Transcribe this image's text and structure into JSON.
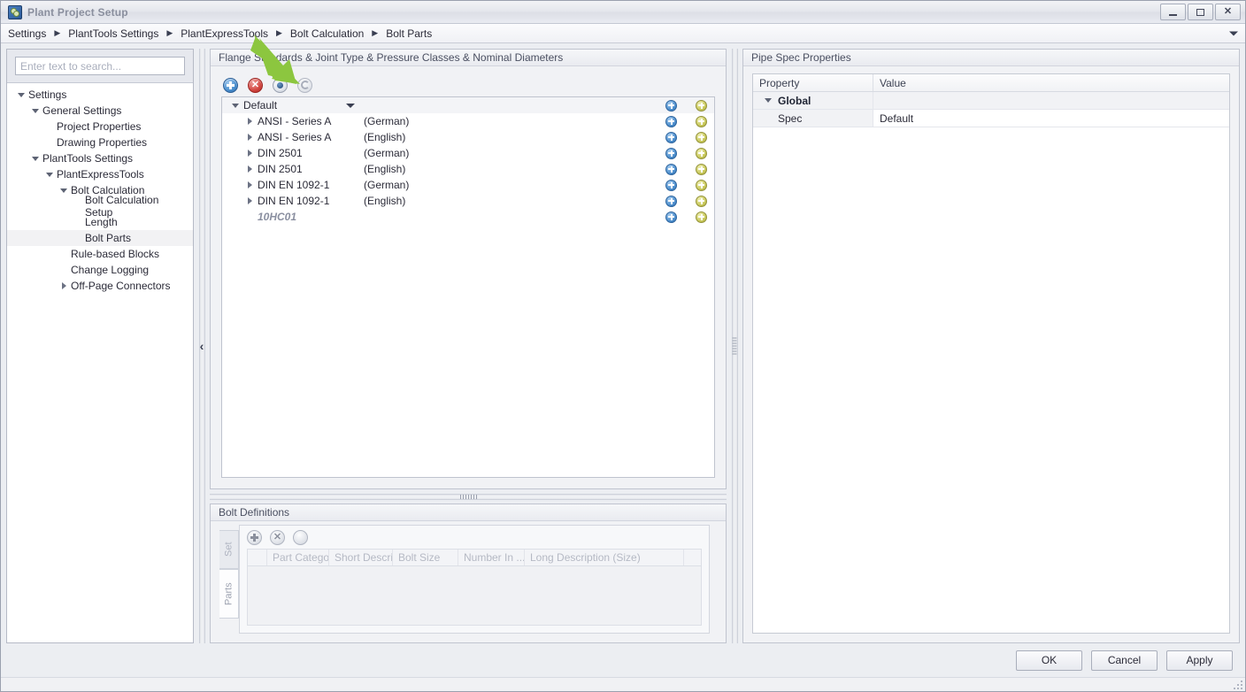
{
  "window": {
    "title": "Plant Project Setup",
    "icon": "app-icon",
    "controls": {
      "minimize": "–",
      "maximize": "□",
      "close": "✕"
    }
  },
  "breadcrumb": {
    "items": [
      "Settings",
      "PlantTools Settings",
      "PlantExpressTools",
      "Bolt Calculation",
      "Bolt Parts"
    ],
    "separator": "▶",
    "dropdown_icon": "chevron-down-icon"
  },
  "sidebar": {
    "search": {
      "placeholder": "Enter text to search...",
      "value": ""
    },
    "tree": [
      {
        "label": "Settings",
        "depth": 0,
        "state": "expanded",
        "selected": false
      },
      {
        "label": "General Settings",
        "depth": 1,
        "state": "expanded",
        "selected": false
      },
      {
        "label": "Project Properties",
        "depth": 2,
        "state": "leaf",
        "selected": false
      },
      {
        "label": "Drawing Properties",
        "depth": 2,
        "state": "leaf",
        "selected": false
      },
      {
        "label": "PlantTools Settings",
        "depth": 1,
        "state": "expanded",
        "selected": false
      },
      {
        "label": "PlantExpressTools",
        "depth": 2,
        "state": "expanded",
        "selected": false
      },
      {
        "label": "Bolt Calculation",
        "depth": 3,
        "state": "expanded",
        "selected": false
      },
      {
        "label": "Bolt Calculation Setup",
        "depth": 4,
        "state": "leaf",
        "selected": false
      },
      {
        "label": "Length",
        "depth": 4,
        "state": "leaf",
        "selected": false
      },
      {
        "label": "Bolt Parts",
        "depth": 4,
        "state": "leaf",
        "selected": true
      },
      {
        "label": "Rule-based Blocks",
        "depth": 3,
        "state": "leaf",
        "selected": false
      },
      {
        "label": "Change Logging",
        "depth": 3,
        "state": "leaf",
        "selected": false
      },
      {
        "label": "Off-Page Connectors",
        "depth": 3,
        "state": "collapsed",
        "selected": false
      }
    ],
    "collapse_handle": "‹"
  },
  "flange_panel": {
    "title": "Flange Standards & Joint Type & Pressure Classes & Nominal Diameters",
    "toolbar": [
      {
        "name": "add-icon",
        "glyph": "+"
      },
      {
        "name": "delete-icon",
        "glyph": "✕"
      },
      {
        "name": "eye-icon",
        "glyph": ""
      },
      {
        "name": "refresh-icon",
        "glyph": ""
      }
    ],
    "rows": [
      {
        "name": "Default",
        "lang": "",
        "state": "expanded",
        "italic": false,
        "has_dropdown": true
      },
      {
        "name": "ANSI - Series A",
        "lang": "(German)",
        "state": "collapsed",
        "italic": false,
        "has_dropdown": false
      },
      {
        "name": "ANSI - Series A",
        "lang": "(English)",
        "state": "collapsed",
        "italic": false,
        "has_dropdown": false
      },
      {
        "name": "DIN 2501",
        "lang": "(German)",
        "state": "collapsed",
        "italic": false,
        "has_dropdown": false
      },
      {
        "name": "DIN 2501",
        "lang": "(English)",
        "state": "collapsed",
        "italic": false,
        "has_dropdown": false
      },
      {
        "name": "DIN EN 1092-1",
        "lang": "(German)",
        "state": "collapsed",
        "italic": false,
        "has_dropdown": false
      },
      {
        "name": "DIN EN 1092-1",
        "lang": "(English)",
        "state": "collapsed",
        "italic": false,
        "has_dropdown": false
      },
      {
        "name": "10HC01",
        "lang": "",
        "state": "leaf",
        "italic": true,
        "has_dropdown": false
      }
    ],
    "row_action_icons": [
      "add-blue-icon",
      "add-yellow-icon"
    ]
  },
  "bolt_definitions": {
    "title": "Bolt Definitions",
    "tabs": [
      {
        "label": "Set",
        "active": false
      },
      {
        "label": "Parts",
        "active": true
      }
    ],
    "toolbar": [
      {
        "name": "add-icon",
        "glyph": "+"
      },
      {
        "name": "delete-icon",
        "glyph": "✕"
      },
      {
        "name": "refresh-icon",
        "glyph": ""
      }
    ],
    "columns": [
      {
        "label": "",
        "width": 22
      },
      {
        "label": "Part Catego...",
        "width": 70
      },
      {
        "label": "Short Descri...",
        "width": 72
      },
      {
        "label": "Bolt Size",
        "width": 74
      },
      {
        "label": "Number In ...",
        "width": 75
      },
      {
        "label": "Long Description (Size)",
        "width": 180
      }
    ],
    "rows": []
  },
  "pipe_spec": {
    "title": "Pipe Spec  Properties",
    "columns": [
      "Property",
      "Value"
    ],
    "rows": [
      {
        "property": "Global",
        "value": "",
        "type": "group",
        "state": "expanded"
      },
      {
        "property": "Spec",
        "value": "Default",
        "type": "item",
        "state": "leaf"
      }
    ]
  },
  "footer": {
    "buttons": [
      {
        "label": "OK"
      },
      {
        "label": "Cancel"
      },
      {
        "label": "Apply"
      }
    ]
  },
  "annotation": {
    "type": "arrow",
    "color": "#8cc63f",
    "points_to": "eye-icon"
  }
}
